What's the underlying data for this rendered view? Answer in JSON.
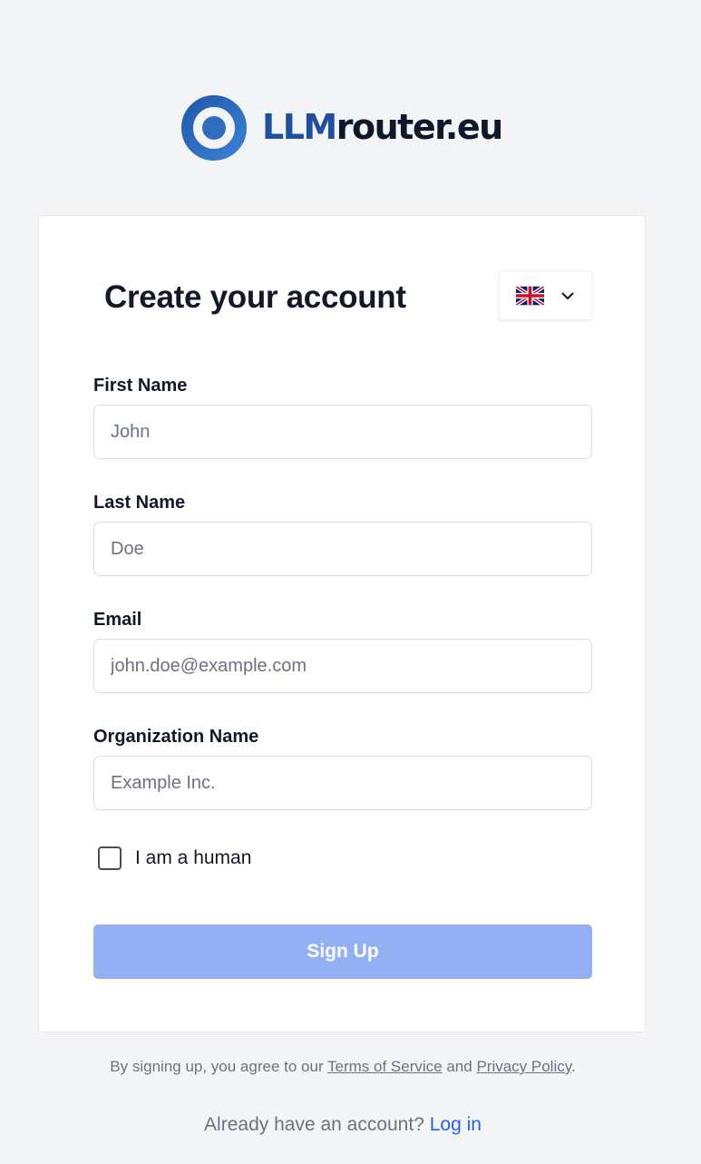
{
  "brand": {
    "name_primary": "LLM",
    "name_secondary": "router.eu",
    "colors": {
      "logo_blue": "#2563b8",
      "name_primary": "#1e4fa0",
      "name_secondary": "#0f172a"
    }
  },
  "form": {
    "title": "Create your account",
    "language_selector": {
      "selected_icon": "uk-flag-icon",
      "dropdown_icon": "chevron-down-icon"
    },
    "fields": {
      "first_name": {
        "label": "First Name",
        "placeholder": "John",
        "value": ""
      },
      "last_name": {
        "label": "Last Name",
        "placeholder": "Doe",
        "value": ""
      },
      "email": {
        "label": "Email",
        "placeholder": "john.doe@example.com",
        "value": ""
      },
      "organization": {
        "label": "Organization Name",
        "placeholder": "Example Inc.",
        "value": ""
      }
    },
    "captcha": {
      "label": "I am a human",
      "checked": false
    },
    "submit": {
      "label": "Sign Up",
      "color": "#93b0f4",
      "disabled": true
    }
  },
  "footer": {
    "legal_prefix": "By signing up, you agree to our ",
    "terms_link": "Terms of Service",
    "legal_and": " and ",
    "privacy_link": "Privacy Policy",
    "legal_suffix": ".",
    "login_prompt": "Already have an account? ",
    "login_link": "Log in",
    "link_color": "#2563eb"
  }
}
